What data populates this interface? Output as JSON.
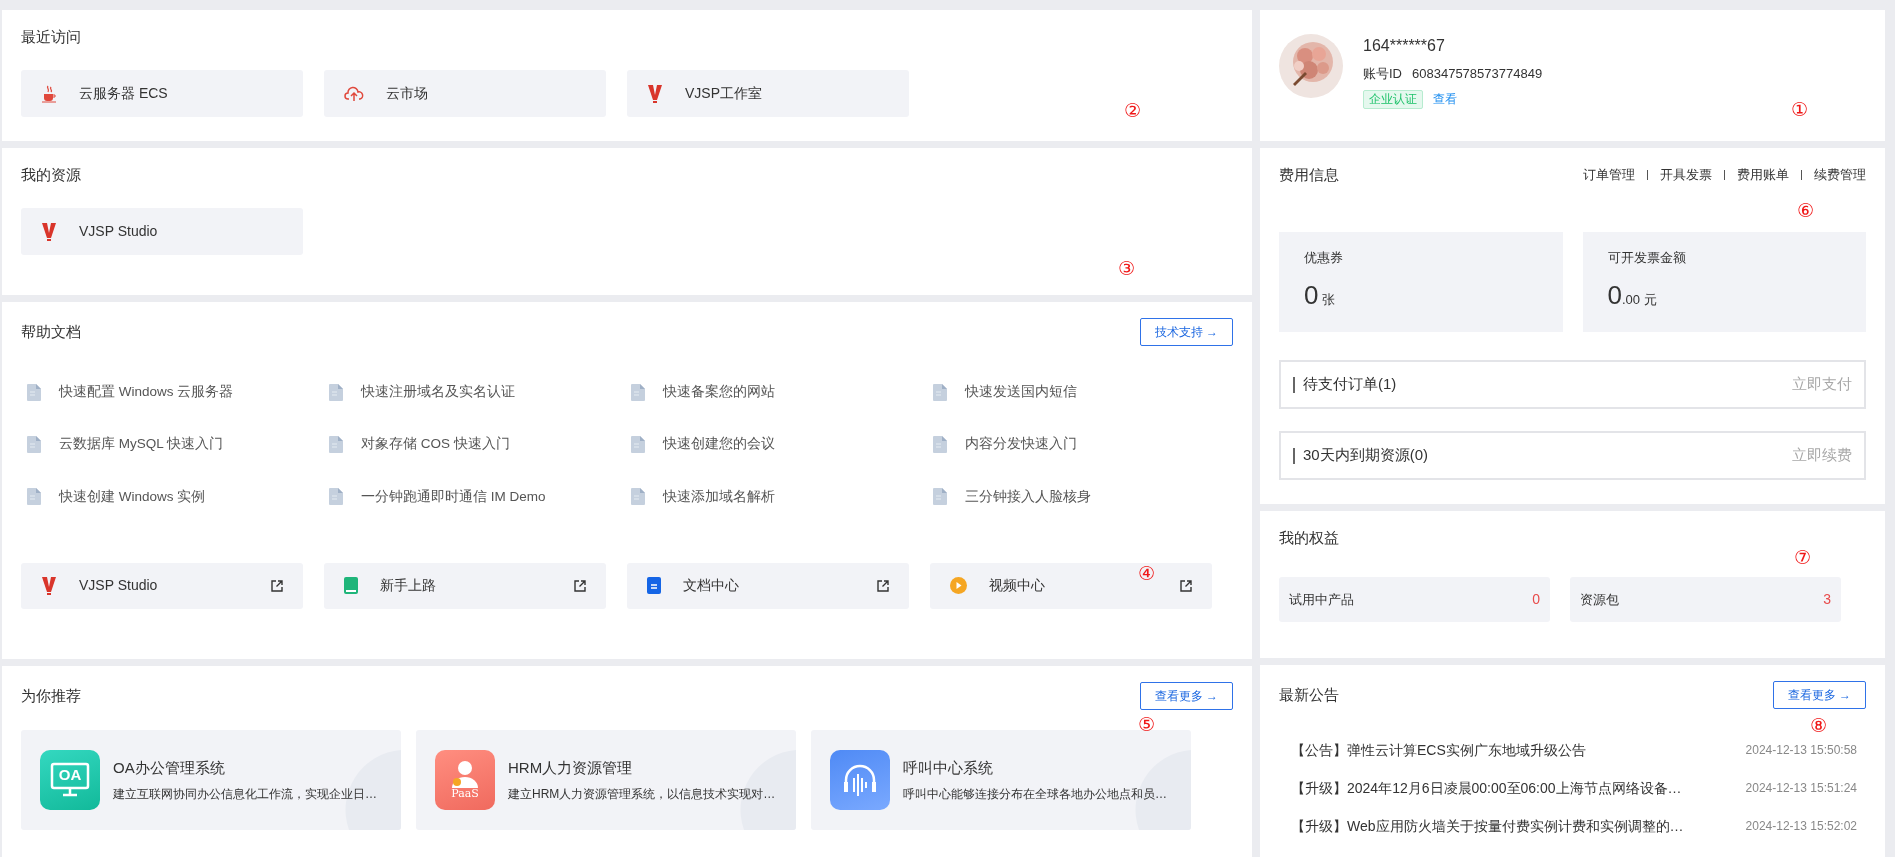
{
  "recent": {
    "title": "最近访问",
    "marker": "②",
    "items": [
      {
        "kind": "java",
        "label": "云服务器 ECS"
      },
      {
        "kind": "cloud",
        "label": "云市场"
      },
      {
        "kind": "vlogo",
        "label": "VJSP工作室"
      }
    ]
  },
  "resources": {
    "title": "我的资源",
    "marker": "③",
    "items": [
      {
        "kind": "vlogo",
        "label": "VJSP Studio"
      }
    ]
  },
  "help": {
    "title": "帮助文档",
    "button": "技术支持 →",
    "marker": "④",
    "docs": [
      "快速配置 Windows 云服务器",
      "快速注册域名及实名认证",
      "快速备案您的网站",
      "快速发送国内短信",
      "云数据库 MySQL 快速入门",
      "对象存储 COS 快速入门",
      "快速创建您的会议",
      "内容分发快速入门",
      "快速创建 Windows 实例",
      "一分钟跑通即时通信 IM Demo",
      "快速添加域名解析",
      "三分钟接入人脸核身"
    ],
    "links": [
      {
        "kind": "vlogo",
        "label": "VJSP Studio"
      },
      {
        "kind": "book",
        "label": "新手上路"
      },
      {
        "kind": "doc",
        "label": "文档中心"
      },
      {
        "kind": "play",
        "label": "视频中心"
      }
    ]
  },
  "recommend": {
    "title": "为你推荐",
    "button": "查看更多 →",
    "marker": "⑤",
    "items": [
      {
        "kind": "oa",
        "icon_label": "OA",
        "name": "OA办公管理系统",
        "desc": "建立互联网协同办公信息化工作流，实现企业日…"
      },
      {
        "kind": "hrm",
        "icon_label": "PaaS",
        "name": "HRM人力资源管理",
        "desc": "建立HRM人力资源管理系统，以信息技术实现对…"
      },
      {
        "kind": "call",
        "name": "呼叫中心系统",
        "desc": "呼叫中心能够连接分布在全球各地办公地点和员…"
      }
    ]
  },
  "profile": {
    "account": "164******67",
    "id_label": "账号ID",
    "id": "608347578573774849",
    "badge": "企业认证",
    "link": "查看",
    "marker": "①"
  },
  "fees": {
    "title": "费用信息",
    "marker": "⑥",
    "links": [
      "订单管理",
      "开具发票",
      "费用账单",
      "续费管理"
    ],
    "stats": [
      {
        "label": "优惠券",
        "value": "0",
        "unit": "张"
      },
      {
        "label": "可开发票金额",
        "value": "0",
        "fraction": ".00",
        "unit": "元"
      }
    ],
    "pending": [
      {
        "label": "待支付订单(1)",
        "action": "立即支付"
      },
      {
        "label": "30天内到期资源(0)",
        "action": "立即续费"
      }
    ]
  },
  "rights": {
    "title": "我的权益",
    "marker": "⑦",
    "items": [
      {
        "label": "试用中产品",
        "count": "0"
      },
      {
        "label": "资源包",
        "count": "3"
      }
    ]
  },
  "notices": {
    "title": "最新公告",
    "button": "查看更多 →",
    "marker": "⑧",
    "items": [
      {
        "text": "【公告】弹性云计算ECS实例广东地域升级公告",
        "time": "2024-12-13 15:50:58"
      },
      {
        "text": "【升级】2024年12月6日凌晨00:00至06:00上海节点网络设备…",
        "time": "2024-12-13 15:51:24"
      },
      {
        "text": "【升级】Web应用防火墙关于按量付费实例计费和实例调整的…",
        "time": "2024-12-13 15:52:02"
      }
    ]
  }
}
